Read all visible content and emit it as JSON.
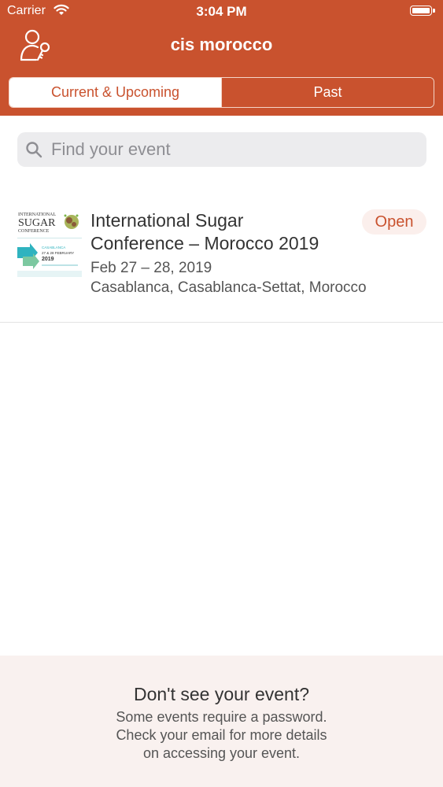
{
  "status_bar": {
    "carrier": "Carrier",
    "time": "3:04 PM"
  },
  "header": {
    "title": "cis morocco",
    "icon": "user-key-icon",
    "background_color": "#c9522e"
  },
  "tabs": [
    {
      "label": "Current & Upcoming",
      "selected": true
    },
    {
      "label": "Past",
      "selected": false
    }
  ],
  "search": {
    "placeholder": "Find your event",
    "icon": "search-icon"
  },
  "events": [
    {
      "title_line1": "International Sugar",
      "title_line2": "Conference – Morocco 2019",
      "date": "Feb 27 – 28, 2019",
      "location": "Casablanca, Casablanca-Settat, Morocco",
      "status": "Open",
      "logo": {
        "line1": "INTERNATIONAL",
        "line2": "SUGAR",
        "line3": "CONFERENCE",
        "city": "CASABLANCA",
        "dates": "27 & 28 FEBRUARY",
        "year": "2019"
      }
    }
  ],
  "footer": {
    "heading": "Don't see your event?",
    "line1": "Some events require a password.",
    "line2": "Check your email for more details",
    "line3": "on accessing your event."
  },
  "colors": {
    "accent": "#c9522e",
    "badge_background": "#fbefec",
    "footer_background": "#f9f1ef"
  }
}
